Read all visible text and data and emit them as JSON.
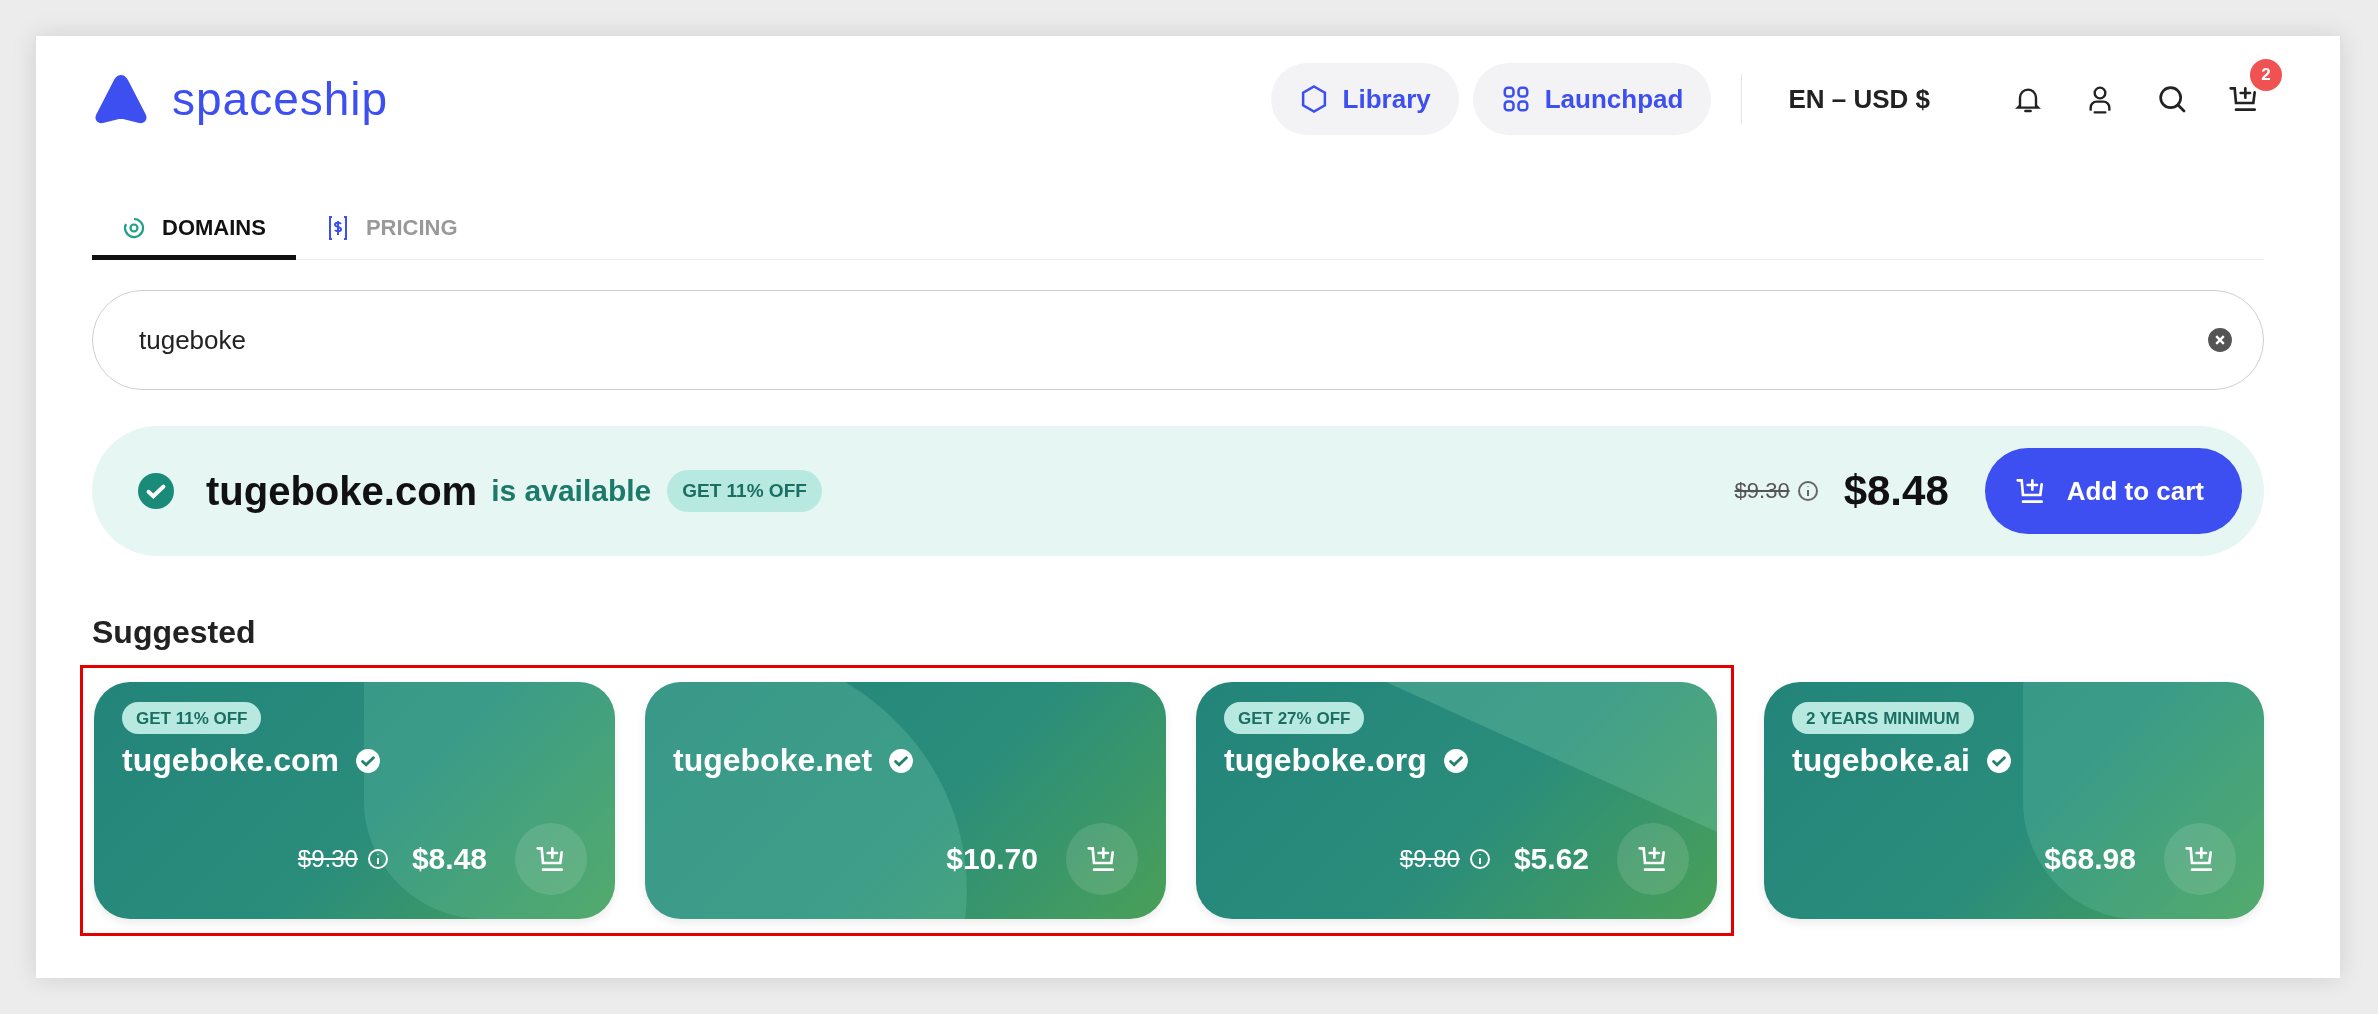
{
  "header": {
    "logo": "spaceship",
    "nav": [
      {
        "label": "Library"
      },
      {
        "label": "Launchpad"
      }
    ],
    "locale": "EN – USD $",
    "cart_count": "2"
  },
  "tabs": [
    {
      "label": "DOMAINS",
      "selected": true
    },
    {
      "label": "PRICING",
      "selected": false
    }
  ],
  "search": {
    "value": "tugeboke"
  },
  "availability": {
    "domain": "tugeboke.com",
    "status": "is available",
    "badge": "GET 11% OFF",
    "old_price": "$9.30",
    "price": "$8.48",
    "button": "Add to cart"
  },
  "suggested": {
    "title": "Suggested",
    "cards": [
      {
        "badge": "GET 11% OFF",
        "domain": "tugeboke.com",
        "old_price": "$9.30",
        "price": "$8.48",
        "highlighted": true
      },
      {
        "domain": "tugeboke.net",
        "price": "$10.70",
        "highlighted": true
      },
      {
        "badge": "GET 27% OFF",
        "domain": "tugeboke.org",
        "old_price": "$9.80",
        "price": "$5.62",
        "highlighted": true
      },
      {
        "badge": "2 YEARS MINIMUM",
        "domain": "tugeboke.ai",
        "price": "$68.98",
        "highlighted": false
      }
    ]
  }
}
